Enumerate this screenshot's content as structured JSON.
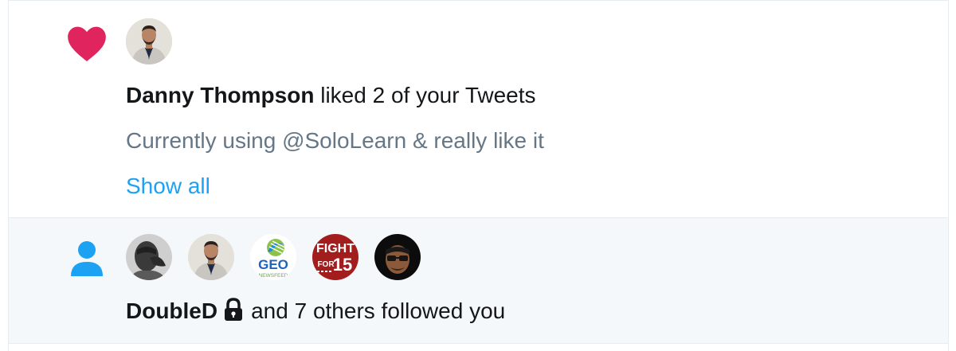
{
  "like_notification": {
    "icon": "heart-icon",
    "icon_color": "#e0245e",
    "actor_name": "Danny Thompson",
    "action_text": " liked 2 of your Tweets",
    "tweet_preview": "Currently using @SoloLearn & really like it",
    "show_all_label": "Show all"
  },
  "follow_notification": {
    "icon": "person-icon",
    "icon_color": "#1da1f2",
    "actor_name": "DoubleD",
    "actor_protected_icon": "lock-icon",
    "action_text": "and 7 others followed you",
    "avatar_labels": {
      "geo_line1": "GEO",
      "geo_line2": "NEWSFEED",
      "fight_line1": "FIGHT",
      "fight_line2": "FOR",
      "fight_line3": "15"
    }
  },
  "colors": {
    "secondary_text": "#657786",
    "link": "#1da1f2",
    "divider": "#e6ecf0",
    "highlight_bg": "#f5f8fa"
  }
}
